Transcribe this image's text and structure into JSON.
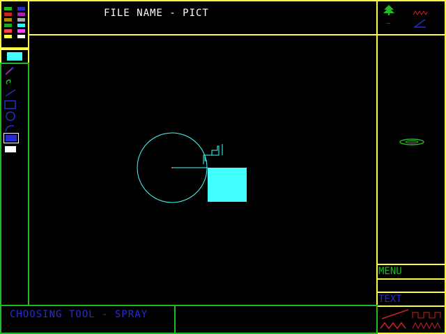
{
  "header": {
    "title": "FILE NAME - PICT"
  },
  "palette": {
    "colors": [
      "#22bb22",
      "#2a2ad0",
      "#cc2222",
      "#aa22aa",
      "#aa8800",
      "#aaaaaa",
      "#22aa22",
      "#22ffff",
      "#ff4444",
      "#ff44ff",
      "#ffff44",
      "#ffffff"
    ],
    "current_color": "#44ffff"
  },
  "tools": [
    {
      "name": "spray-tool-icon"
    },
    {
      "name": "brush-tool-icon"
    },
    {
      "name": "line-tool-icon"
    },
    {
      "name": "rectangle-tool-icon"
    },
    {
      "name": "circle-tool-icon"
    },
    {
      "name": "curve-tool-icon"
    },
    {
      "name": "filled-rectangle-tool-icon"
    },
    {
      "name": "eraser-tool-icon"
    }
  ],
  "options": [
    {
      "name": "tree-icon"
    },
    {
      "name": "zigzag-icon"
    },
    {
      "name": "dash-icon"
    },
    {
      "name": "angle-icon"
    }
  ],
  "side_preview": {
    "icon": "spray-pattern-icon"
  },
  "menu": {
    "label": "MENU"
  },
  "text_tool": {
    "label": "TEXT"
  },
  "waveforms": {
    "icon": "waveform-icon"
  },
  "status": {
    "message": "CHOOSING TOOL - SPRAY"
  },
  "canvas": {
    "shapes": [
      "circle",
      "line",
      "staircase-polyline",
      "filled-rectangle"
    ],
    "stroke_color": "#44ffff",
    "fill_color": "#44ffff",
    "center_point_color": "#ff4444"
  }
}
